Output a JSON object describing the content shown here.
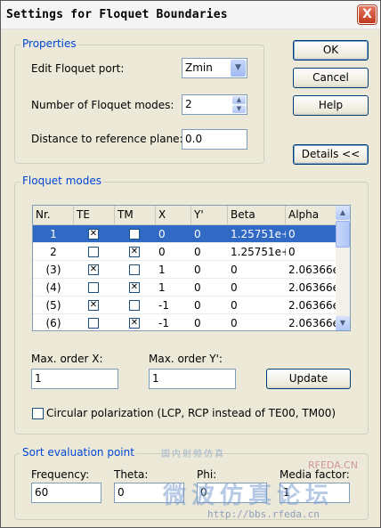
{
  "window": {
    "title": "Settings for Floquet Boundaries",
    "close_label": "X"
  },
  "buttons": {
    "ok": "OK",
    "cancel": "Cancel",
    "help": "Help",
    "details": "Details <<",
    "update": "Update"
  },
  "properties": {
    "title": "Properties",
    "port_label": "Edit Floquet port:",
    "port_value": "Zmin",
    "modes_label": "Number of Floquet modes:",
    "modes_value": "2",
    "distance_label": "Distance to reference plane:",
    "distance_value": "0.0"
  },
  "floquet": {
    "title": "Floquet modes",
    "columns": [
      "Nr.",
      "TE",
      "TM",
      "X",
      "Y'",
      "Beta",
      "Alpha"
    ],
    "rows": [
      {
        "nr": "1",
        "te": true,
        "tm": false,
        "x": "0",
        "y": "0",
        "beta": "1.25751e+",
        "alpha": "0",
        "selected": true
      },
      {
        "nr": "2",
        "te": false,
        "tm": true,
        "x": "0",
        "y": "0",
        "beta": "1.25751e+",
        "alpha": "0",
        "selected": false
      },
      {
        "nr": "(3)",
        "te": true,
        "tm": false,
        "x": "1",
        "y": "0",
        "beta": "0",
        "alpha": "2.06366e-",
        "selected": false
      },
      {
        "nr": "(4)",
        "te": false,
        "tm": true,
        "x": "1",
        "y": "0",
        "beta": "0",
        "alpha": "2.06366e-",
        "selected": false
      },
      {
        "nr": "(5)",
        "te": true,
        "tm": false,
        "x": "-1",
        "y": "0",
        "beta": "0",
        "alpha": "2.06366e-",
        "selected": false
      },
      {
        "nr": "(6)",
        "te": false,
        "tm": true,
        "x": "-1",
        "y": "0",
        "beta": "0",
        "alpha": "2.06366e-",
        "selected": false
      }
    ],
    "max_x_label": "Max. order X:",
    "max_x_value": "1",
    "max_y_label": "Max. order Y':",
    "max_y_value": "1",
    "circular_label": "Circular polarization (LCP, RCP instead of TE00, TM00)",
    "circular_checked": false
  },
  "sort": {
    "title": "Sort evaluation point",
    "frequency_label": "Frequency:",
    "frequency_value": "60",
    "theta_label": "Theta:",
    "theta_value": "0",
    "phi_label": "Phi:",
    "phi_value": "0",
    "media_label": "Media factor:",
    "media_value": "1"
  },
  "watermark": {
    "top": "RFEDA.CN",
    "main": "微波仿真论坛",
    "url": "http://bbs.rfeda.cn",
    "small": "国内射频仿真"
  },
  "colors": {
    "accent": "#0046d5",
    "selection": "#316ac5"
  },
  "icons": {
    "close": "close-icon",
    "dropdown": "chevron-down-icon",
    "spin_up": "arrow-up-icon",
    "spin_down": "arrow-down-icon",
    "check": "check-icon"
  }
}
